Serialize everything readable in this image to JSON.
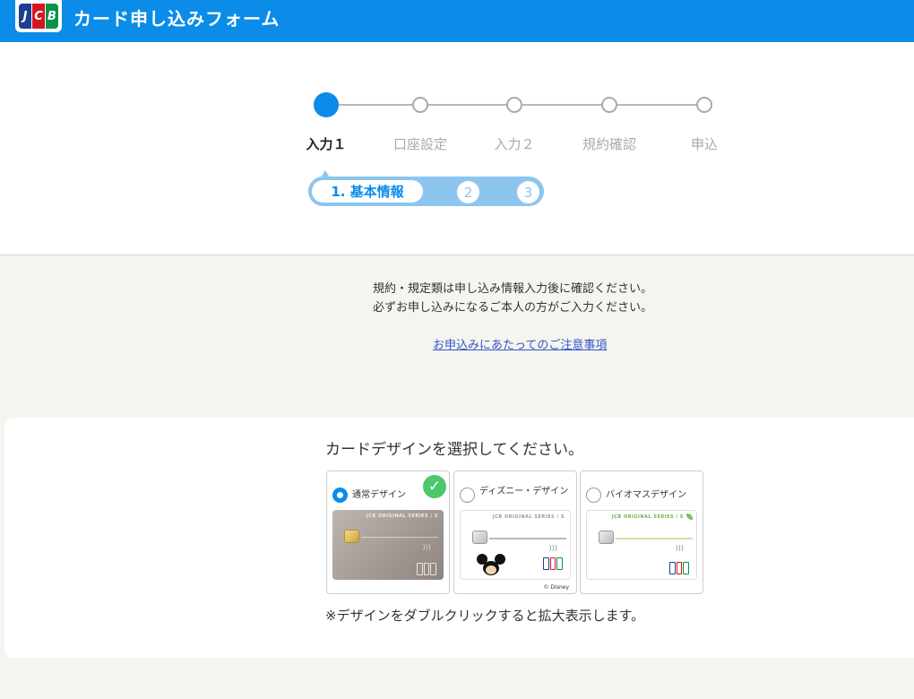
{
  "header": {
    "logo_letters": [
      "J",
      "C",
      "B"
    ],
    "title": "カード申し込みフォーム"
  },
  "stepper": {
    "steps": [
      {
        "label": "入力１",
        "active": true
      },
      {
        "label": "口座設定",
        "active": false
      },
      {
        "label": "入力２",
        "active": false
      },
      {
        "label": "規約確認",
        "active": false
      },
      {
        "label": "申込",
        "active": false
      }
    ],
    "substeps": {
      "current": "1. 基本情報",
      "others": [
        "2",
        "3"
      ]
    }
  },
  "notice": {
    "line1": "規約・規定類は申し込み情報入力後に確認ください。",
    "line2": "必ずお申し込みになるご本人の方がご入力ください。",
    "link": "お申込みにあたってのご注意事項"
  },
  "design": {
    "title": "カードデザインを選択してください。",
    "options": [
      {
        "label": "通常デザイン",
        "selected": true,
        "card_series": "JCB ORIGINAL SERIES / S"
      },
      {
        "label": "ディズニー・デザイン",
        "selected": false,
        "card_series": "JCB ORIGINAL SERIES / S",
        "copyright": "© Disney"
      },
      {
        "label": "バイオマスデザイン",
        "selected": false,
        "card_series": "JCB ORIGINAL SERIES / S"
      }
    ],
    "note": "※デザインをダブルクリックすると拡大表示します。"
  },
  "colors": {
    "brand_blue": "#0a8ce8",
    "substep_light": "#8cc6ef",
    "check_green": "#4cc76a"
  }
}
